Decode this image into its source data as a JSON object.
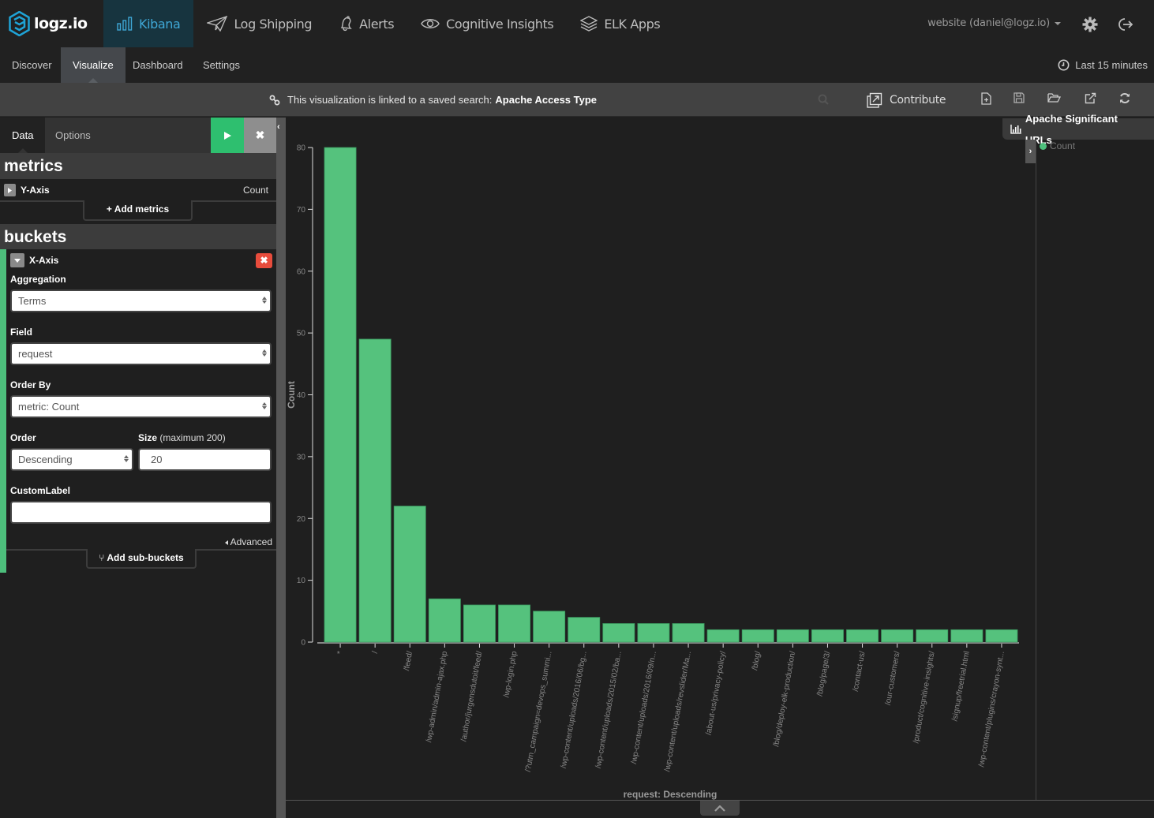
{
  "brand": {
    "name": "logz.io",
    "accent": "#3fa7d6"
  },
  "topnav": {
    "items": [
      {
        "label": "Kibana",
        "icon": "bar-chart-icon",
        "active": true
      },
      {
        "label": "Log Shipping",
        "icon": "paper-plane-icon"
      },
      {
        "label": "Alerts",
        "icon": "bell-icon"
      },
      {
        "label": "Cognitive Insights",
        "icon": "eye-icon"
      },
      {
        "label": "ELK Apps",
        "icon": "layers-icon"
      }
    ],
    "account": "website (daniel@logz.io)",
    "settings_icon": "gear-icon",
    "logout_icon": "logout-icon"
  },
  "subnav": {
    "items": [
      {
        "label": "Discover"
      },
      {
        "label": "Visualize",
        "active": true
      },
      {
        "label": "Dashboard"
      },
      {
        "label": "Settings"
      }
    ],
    "timepicker": "Last 15 minutes"
  },
  "linkbar": {
    "message": "This visualization is linked to a saved search:",
    "saved_search": "Apache Access Type",
    "contribute_label": "Contribute",
    "toolbar_icons": [
      "new-visualization-icon",
      "save-icon",
      "open-icon",
      "share-icon",
      "refresh-icon"
    ]
  },
  "editor": {
    "tabs": [
      {
        "label": "Data",
        "active": true
      },
      {
        "label": "Options"
      }
    ],
    "apply_icon": "play-icon",
    "discard_label": "✖",
    "metrics": {
      "title": "metrics",
      "agg_title": "Y-Axis",
      "agg_value": "Count",
      "add_label": "+ Add metrics"
    },
    "buckets": {
      "title": "buckets",
      "agg_title": "X-Axis",
      "remove_label": "✖",
      "aggregation_label": "Aggregation",
      "aggregation_value": "Terms",
      "field_label": "Field",
      "field_value": "request",
      "orderby_label": "Order By",
      "orderby_value": "metric: Count",
      "order_label": "Order",
      "order_value": "Descending",
      "size_label": "Size",
      "size_hint": "(maximum 200)",
      "size_value": "20",
      "customlabel_label": "CustomLabel",
      "customlabel_value": "",
      "advanced_label": "Advanced",
      "add_sub_label": "Add sub-buckets"
    }
  },
  "visualization": {
    "title": "Apache Significant URLs",
    "legend": [
      {
        "label": "Count",
        "color": "#4dbf7c"
      }
    ]
  },
  "chart_data": {
    "type": "bar",
    "title": "Apache Significant URLs",
    "xlabel": "request: Descending",
    "ylabel": "Count",
    "ylim": [
      0,
      80
    ],
    "yticks": [
      0,
      10,
      20,
      30,
      40,
      50,
      60,
      70,
      80
    ],
    "grid": false,
    "legend": "right",
    "bar_color": "#55c27d",
    "categories": [
      "*",
      "/",
      "/feed/",
      "/wp-admin/admin-ajax.php",
      "/author/jurgensdutoit/feed/",
      "/wp-login.php",
      "/?utm_campaign=devops_summi...",
      "/wp-content/uploads/2016/06/bg...",
      "/wp-content/uploads/2015/02/ba...",
      "/wp-content/uploads/2016/09/n...",
      "/wp-content/uploads/revslider/Ma...",
      "/about-us/privacy-policy/",
      "/blog/",
      "/blog/deploy-elk-production/",
      "/blog/page/3/",
      "/contact-us/",
      "/our-customers/",
      "/product/cognitive-insights/",
      "/signup/freetrial.html",
      "/wp-content/plugins/crayon-synt..."
    ],
    "series": [
      {
        "name": "Count",
        "values": [
          80,
          49,
          22,
          7,
          6,
          6,
          5,
          4,
          3,
          3,
          3,
          2,
          2,
          2,
          2,
          2,
          2,
          2,
          2,
          2
        ]
      }
    ]
  }
}
